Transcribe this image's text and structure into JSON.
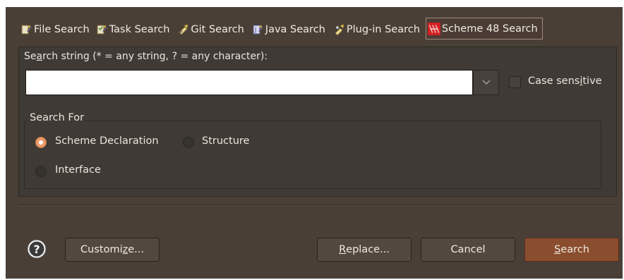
{
  "tabs": [
    {
      "label": "File Search",
      "icon": "file-search-icon",
      "active": false
    },
    {
      "label": "Task Search",
      "icon": "task-search-icon",
      "active": false
    },
    {
      "label": "Git Search",
      "icon": "git-search-icon",
      "active": false
    },
    {
      "label": "Java Search",
      "icon": "java-search-icon",
      "active": false
    },
    {
      "label": "Plug-in Search",
      "icon": "plugin-search-icon",
      "active": false
    },
    {
      "label": "Scheme 48 Search",
      "icon": "scheme48-search-icon",
      "active": true
    }
  ],
  "search_string": {
    "label_pre": "Se",
    "label_mnemonic": "a",
    "label_post": "rch string (* = any string, ? = any character):",
    "value": ""
  },
  "case_sensitive": {
    "label_pre": "Case sens",
    "label_mnemonic": "i",
    "label_post": "tive",
    "checked": false
  },
  "search_for": {
    "title": "Search For",
    "options": [
      {
        "label": "Scheme Declaration",
        "selected": true
      },
      {
        "label": "Structure",
        "selected": false
      },
      {
        "label": "Interface",
        "selected": false
      }
    ]
  },
  "buttons": {
    "customize_pre": "Customi",
    "customize_mnemonic": "z",
    "customize_post": "e...",
    "replace_mnemonic": "R",
    "replace_post": "eplace...",
    "cancel": "Cancel",
    "search_mnemonic": "S",
    "search_post": "earch"
  },
  "colors": {
    "dialog_bg": "#493f37",
    "panel_bg": "#3f3a35",
    "accent": "#eb9a6a",
    "default_button": "#8a4d2e"
  }
}
